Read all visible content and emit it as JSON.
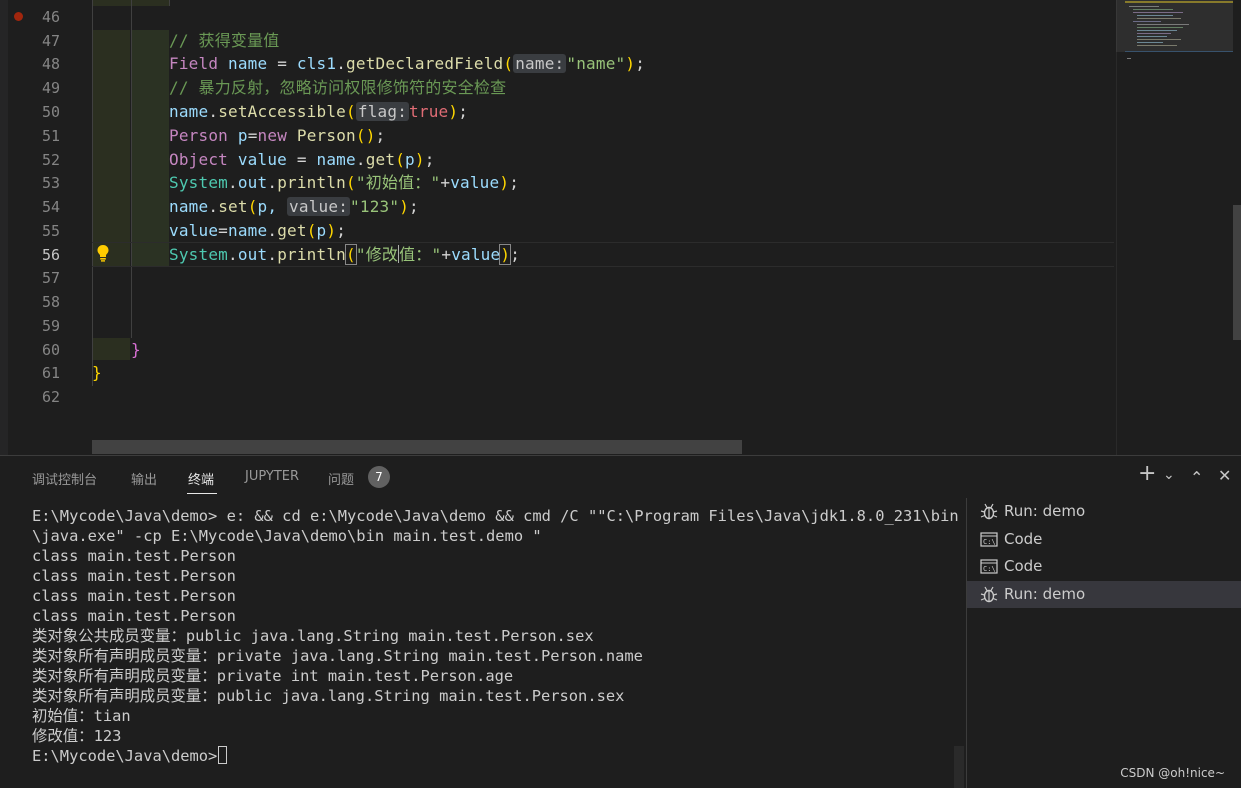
{
  "editor": {
    "lines": [
      {
        "num": "46",
        "text": ""
      },
      {
        "num": "47",
        "text": "// 获得变量值"
      },
      {
        "num": "48",
        "text": "Field name = cls1.getDeclaredField(name: \"name\");"
      },
      {
        "num": "49",
        "text": "// 暴力反射，忽略访问权限修饰符的安全检查"
      },
      {
        "num": "50",
        "text": "name.setAccessible(flag: true);"
      },
      {
        "num": "51",
        "text": "Person p=new Person();"
      },
      {
        "num": "52",
        "text": "Object value = name.get(p);"
      },
      {
        "num": "53",
        "text": "System.out.println(\"初始值：\"+value);"
      },
      {
        "num": "54",
        "text": "name.set(p, value: \"123\");"
      },
      {
        "num": "55",
        "text": "value=name.get(p);"
      },
      {
        "num": "56",
        "text": "System.out.println(\"修改值：\"+value);"
      },
      {
        "num": "57",
        "text": ""
      },
      {
        "num": "58",
        "text": ""
      },
      {
        "num": "59",
        "text": ""
      },
      {
        "num": "60",
        "text": "}"
      },
      {
        "num": "61",
        "text": "}"
      },
      {
        "num": "62",
        "text": ""
      }
    ],
    "tokens": {
      "l47": "// 获得变量值",
      "l48": [
        "Field",
        " ",
        "name",
        " = ",
        "cls1",
        ".",
        "getDeclaredField",
        "(",
        "name:",
        "\"name\"",
        ")",
        ";"
      ],
      "l49": "// 暴力反射，忽略访问权限修饰符的安全检查",
      "l50": [
        "name",
        ".",
        "setAccessible",
        "(",
        "flag:",
        "true",
        ")",
        ";"
      ],
      "l51": [
        "Person",
        " ",
        "p",
        "=",
        "new",
        " ",
        "Person",
        "()",
        ";"
      ],
      "l52": [
        "Object",
        " ",
        "value",
        " = ",
        "name",
        ".",
        "get",
        "(",
        "p",
        ")",
        ";"
      ],
      "l53": [
        "System",
        ".",
        "out",
        ".",
        "println",
        "(",
        "\"初始值：\"",
        "+",
        "value",
        ")",
        ";"
      ],
      "l54": [
        "name",
        ".",
        "set",
        "(",
        "p, ",
        "value:",
        "\"123\"",
        ")",
        ";"
      ],
      "l55": [
        "value",
        "=",
        "name",
        ".",
        "get",
        "(",
        "p",
        ")",
        ";"
      ],
      "l56": [
        "System",
        ".",
        "out",
        ".",
        "println",
        "(",
        "\"修改",
        "值：\"",
        "+",
        "value",
        ")",
        ";"
      ],
      "l60": "}",
      "l61": "}"
    }
  },
  "panel": {
    "tabs": [
      "调试控制台",
      "输出",
      "终端",
      "JUPYTER",
      "问题"
    ],
    "active_tab": "终端",
    "problems_count": "7",
    "actions": {
      "add": "+",
      "dropdown": "⌄",
      "maximize": "⌃",
      "close": "✕"
    }
  },
  "terminal": {
    "lines": [
      "E:\\Mycode\\Java\\demo> e: && cd e:\\Mycode\\Java\\demo && cmd /C \"\"C:\\Program Files\\Java\\jdk1.8.0_231\\bin",
      "\\java.exe\" -cp E:\\Mycode\\Java\\demo\\bin main.test.demo \"",
      "class main.test.Person",
      "class main.test.Person",
      "class main.test.Person",
      "class main.test.Person",
      "类对象公共成员变量：public java.lang.String main.test.Person.sex",
      "类对象所有声明成员变量：private java.lang.String main.test.Person.name",
      "类对象所有声明成员变量：private int main.test.Person.age",
      "类对象所有声明成员变量：public java.lang.String main.test.Person.sex",
      "初始值：tian",
      "修改值：123",
      ""
    ],
    "prompt": "E:\\Mycode\\Java\\demo>",
    "instances": [
      {
        "label": "Run: demo",
        "icon": "debug-icon",
        "selected": false
      },
      {
        "label": "Code",
        "icon": "terminal-icon",
        "selected": false
      },
      {
        "label": "Code",
        "icon": "terminal-icon",
        "selected": false
      },
      {
        "label": "Run: demo",
        "icon": "debug-icon",
        "selected": true
      }
    ]
  },
  "watermark": "CSDN @oh!nice~"
}
